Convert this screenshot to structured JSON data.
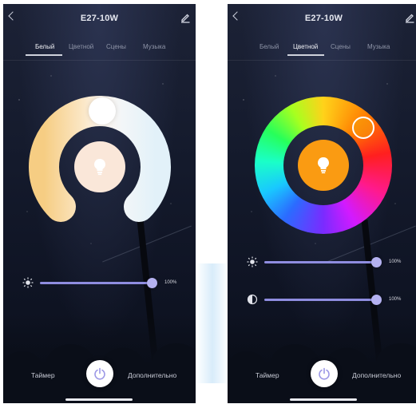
{
  "screens": [
    {
      "title": "E27-10W",
      "tabs": [
        "Белый",
        "Цветной",
        "Сцены",
        "Музыка"
      ],
      "active_tab": "Белый",
      "control": "white-temperature-arc",
      "brightness_pct": "100%",
      "brightness_level": 1.0,
      "bottom": {
        "timer": "Таймер",
        "more": "Дополнительно"
      },
      "colors": {
        "bulb_bg": "#fae7d9",
        "arc_warm": "#f6cd83",
        "arc_cool": "#e6f3fa"
      }
    },
    {
      "title": "E27-10W",
      "tabs": [
        "Белый",
        "Цветной",
        "Сцены",
        "Музыка"
      ],
      "active_tab": "Цветной",
      "control": "hue-ring",
      "brightness_pct": "100%",
      "brightness_level": 1.0,
      "saturation_pct": "100%",
      "saturation_level": 1.0,
      "bottom": {
        "timer": "Таймер",
        "more": "Дополнительно"
      },
      "colors": {
        "bulb_bg": "#fa9b12",
        "selected_hue": "#f5a00f"
      }
    }
  ]
}
